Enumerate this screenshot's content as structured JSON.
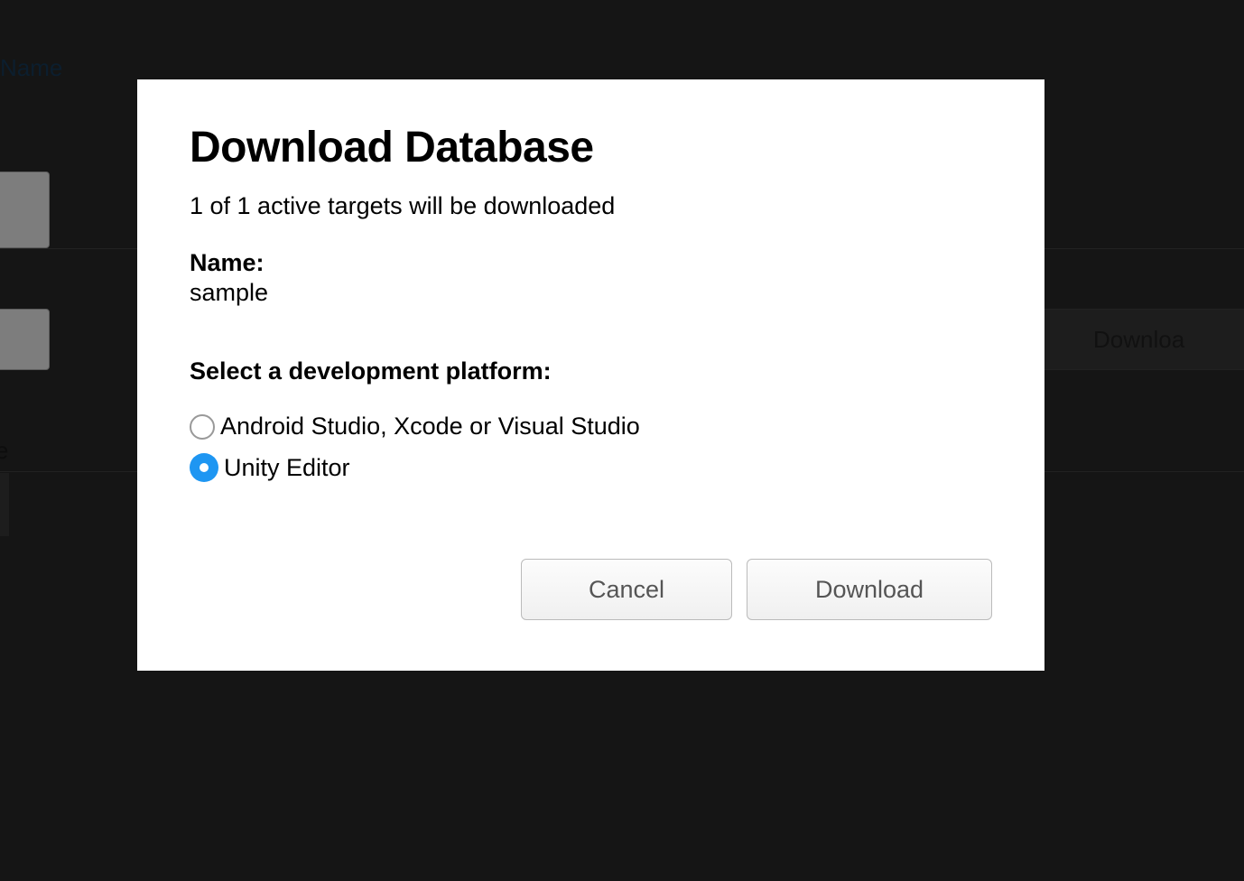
{
  "background": {
    "name_label": "Name",
    "download_text": "Downloa",
    "letter": "e"
  },
  "modal": {
    "title": "Download Database",
    "subtitle": "1 of 1 active targets will be downloaded",
    "name_label": "Name:",
    "name_value": "sample",
    "platform_label": "Select a development platform:",
    "options": [
      {
        "label": "Android Studio, Xcode or Visual Studio",
        "selected": false
      },
      {
        "label": "Unity Editor",
        "selected": true
      }
    ],
    "buttons": {
      "cancel": "Cancel",
      "download": "Download"
    }
  }
}
